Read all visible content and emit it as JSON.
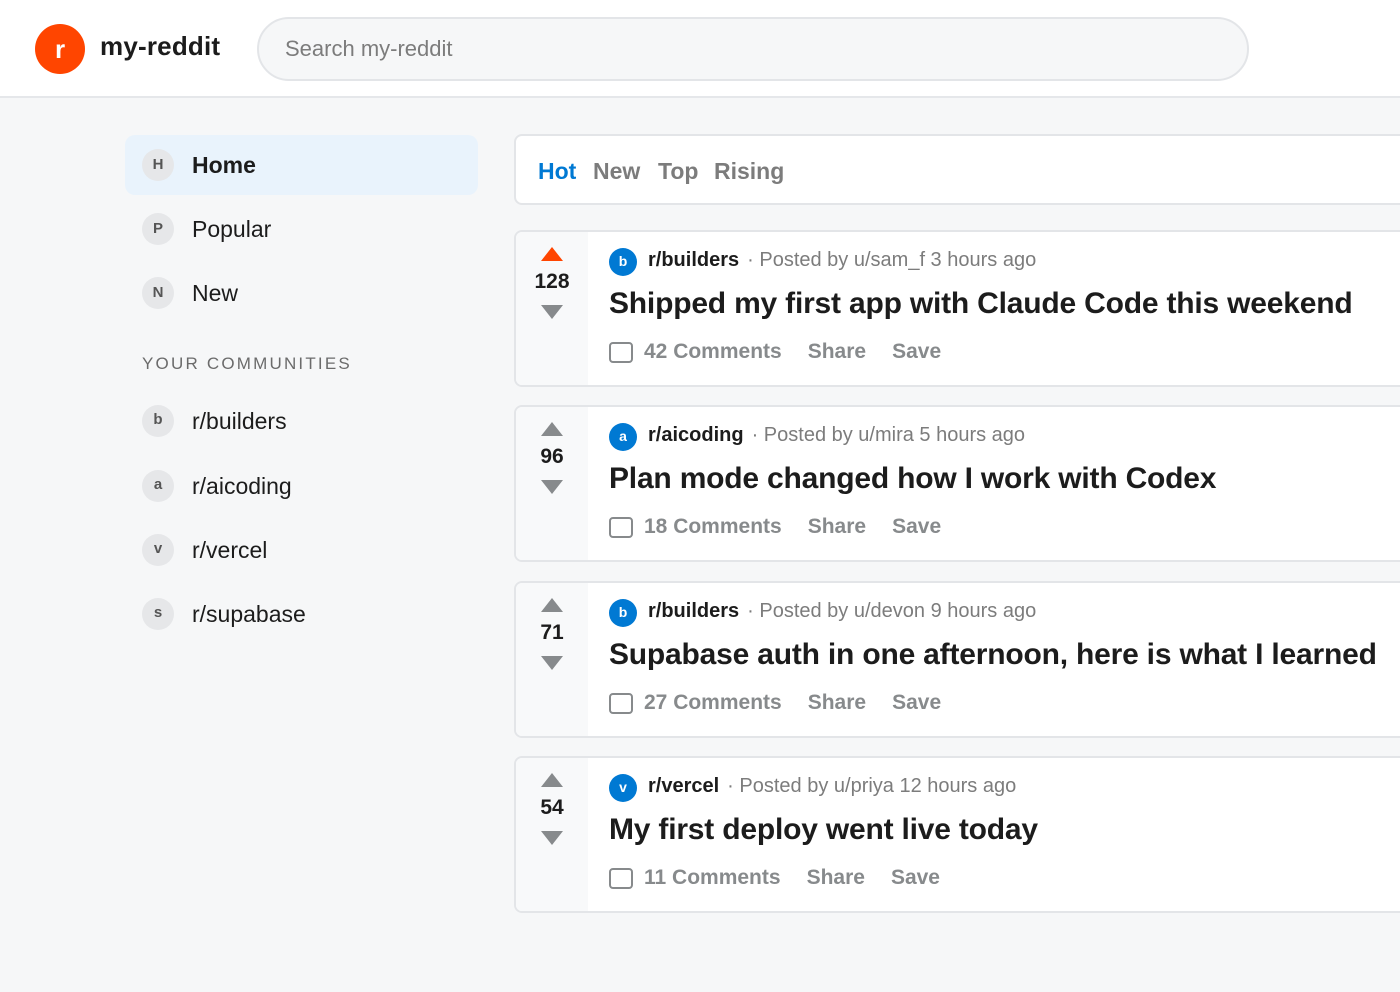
{
  "header": {
    "logo_letter": "r",
    "brand": "my-reddit",
    "search_placeholder": "Search my-reddit",
    "search_value": ""
  },
  "sidebar": {
    "nav": [
      {
        "badge": "H",
        "label": "Home",
        "active": true
      },
      {
        "badge": "P",
        "label": "Popular",
        "active": false
      },
      {
        "badge": "N",
        "label": "New",
        "active": false
      }
    ],
    "communities_title": "YOUR COMMUNITIES",
    "communities": [
      {
        "badge": "b",
        "label": "r/builders"
      },
      {
        "badge": "a",
        "label": "r/aicoding"
      },
      {
        "badge": "v",
        "label": "r/vercel"
      },
      {
        "badge": "s",
        "label": "r/supabase"
      }
    ]
  },
  "sort": {
    "tabs": [
      "Hot",
      "New",
      "Top",
      "Rising"
    ],
    "active": "Hot"
  },
  "posts": [
    {
      "score": "128",
      "upvoted": true,
      "sub_icon": "b",
      "subreddit": "r/builders",
      "meta": "· Posted by u/sam_f 3 hours ago",
      "title": "Shipped my first app with Claude Code this weekend",
      "comments": "42 Comments",
      "share": "Share",
      "save": "Save"
    },
    {
      "score": "96",
      "upvoted": false,
      "sub_icon": "a",
      "subreddit": "r/aicoding",
      "meta": "· Posted by u/mira 5 hours ago",
      "title": "Plan mode changed how I work with Codex",
      "comments": "18 Comments",
      "share": "Share",
      "save": "Save"
    },
    {
      "score": "71",
      "upvoted": false,
      "sub_icon": "b",
      "subreddit": "r/builders",
      "meta": "· Posted by u/devon 9 hours ago",
      "title": "Supabase auth in one afternoon, here is what I learned",
      "comments": "27 Comments",
      "share": "Share",
      "save": "Save"
    },
    {
      "score": "54",
      "upvoted": false,
      "sub_icon": "v",
      "subreddit": "r/vercel",
      "meta": "· Posted by u/priya 12 hours ago",
      "title": "My first deploy went live today",
      "comments": "11 Comments",
      "share": "Share",
      "save": "Save"
    }
  ],
  "colors": {
    "brand": "#ff4500",
    "accent": "#0079d3",
    "active_nav_bg": "#e9f3fc",
    "muted": "#7c7c7c"
  },
  "icons": [
    "comment-icon",
    "upvote-arrow-icon",
    "downvote-arrow-icon"
  ]
}
